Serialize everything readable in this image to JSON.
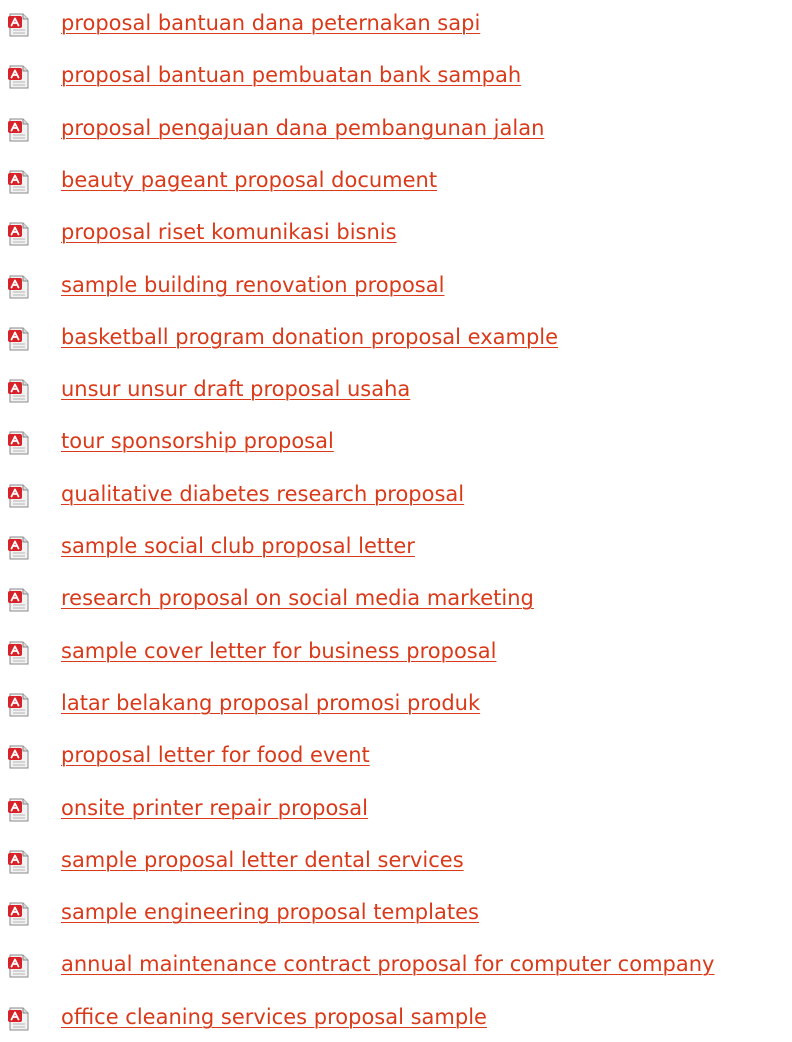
{
  "links": [
    {
      "label": "proposal bantuan dana peternakan sapi",
      "icon": "pdf-file-icon"
    },
    {
      "label": "proposal bantuan pembuatan bank sampah",
      "icon": "pdf-file-icon"
    },
    {
      "label": "proposal pengajuan dana pembangunan jalan",
      "icon": "pdf-file-icon"
    },
    {
      "label": "beauty pageant proposal document",
      "icon": "pdf-file-icon"
    },
    {
      "label": "proposal riset komunikasi bisnis",
      "icon": "pdf-file-icon"
    },
    {
      "label": "sample building renovation proposal",
      "icon": "pdf-file-icon"
    },
    {
      "label": "basketball program donation proposal example",
      "icon": "pdf-file-icon"
    },
    {
      "label": "unsur unsur draft proposal usaha",
      "icon": "pdf-file-icon"
    },
    {
      "label": "tour sponsorship proposal",
      "icon": "pdf-file-icon"
    },
    {
      "label": "qualitative diabetes research proposal",
      "icon": "pdf-file-icon"
    },
    {
      "label": "sample social club proposal letter",
      "icon": "pdf-file-icon"
    },
    {
      "label": "research proposal on social media marketing",
      "icon": "pdf-file-icon"
    },
    {
      "label": "sample cover letter for business proposal",
      "icon": "pdf-file-icon"
    },
    {
      "label": "latar belakang proposal promosi produk",
      "icon": "pdf-file-icon"
    },
    {
      "label": "proposal letter for food event",
      "icon": "pdf-file-icon"
    },
    {
      "label": "onsite printer repair proposal",
      "icon": "pdf-file-icon"
    },
    {
      "label": "sample proposal letter dental services",
      "icon": "pdf-file-icon"
    },
    {
      "label": "sample engineering proposal templates",
      "icon": "pdf-file-icon"
    },
    {
      "label": "annual maintenance contract proposal for computer company",
      "icon": "pdf-file-icon"
    },
    {
      "label": "office cleaning services proposal sample",
      "icon": "pdf-file-icon"
    }
  ],
  "colors": {
    "link": "#d93a1a",
    "icon_red": "#d8222a",
    "icon_page": "#f2f2f2"
  }
}
